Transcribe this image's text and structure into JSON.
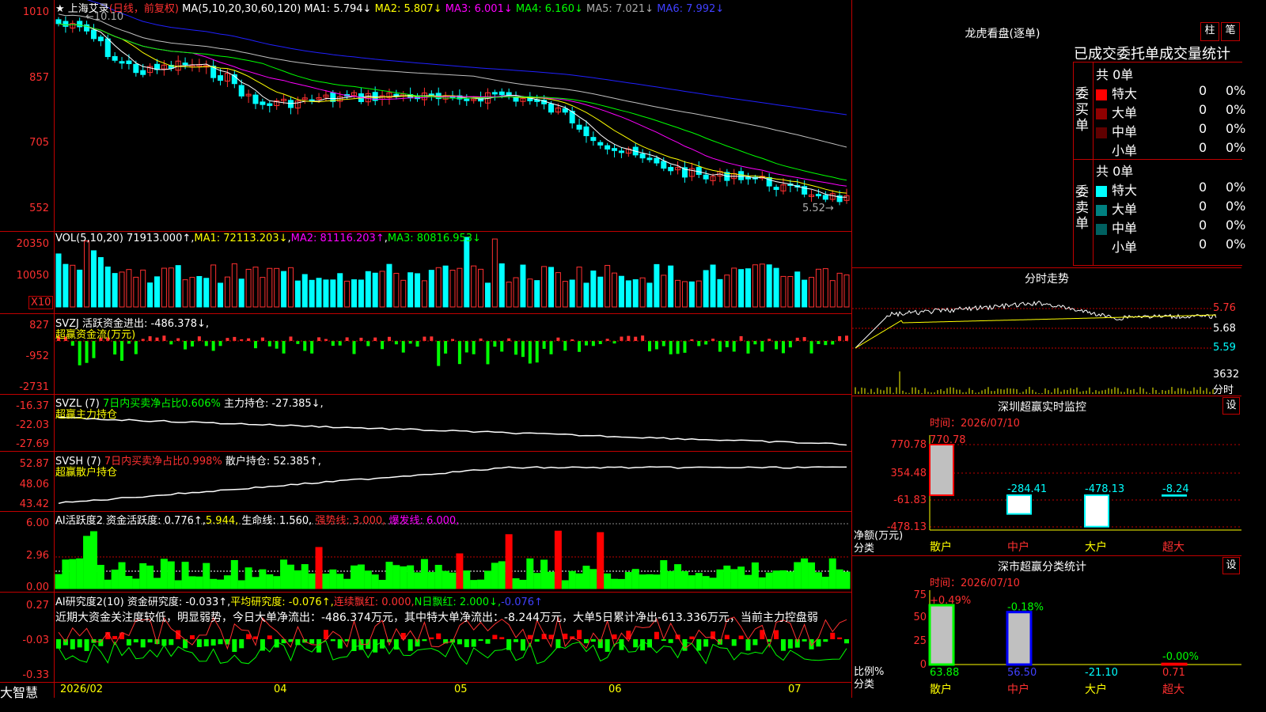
{
  "colors": {
    "up": "#ff3030",
    "down": "#00ffff",
    "grid": "#c00000",
    "ma1": "#ffffff",
    "ma2": "#ffff00",
    "ma3": "#ff00ff",
    "ma4": "#00ff00",
    "ma5": "#c0c0c0",
    "ma6": "#2020ff"
  },
  "stock": {
    "name": "上海艾录",
    "period": "(日线，前复权)",
    "ma_params": "MA(5,10,20,30,60,120)",
    "ma1": "MA1: 5.794↓",
    "ma2": "MA2: 5.807↓",
    "ma3": "MA3: 6.001↓",
    "ma4": "MA4: 6.160↓",
    "ma5": "MA5: 7.021↓",
    "ma6": "MA6: 7.992↓",
    "high_marker": "10.10",
    "low_marker": "5.52"
  },
  "price_axis": [
    "1010",
    "857",
    "705",
    "552"
  ],
  "volume": {
    "label": "VOL(5,10,20)",
    "value": "71913.000↑",
    "ma1": "MA1: 72113.203↓",
    "ma2": "MA2: 81116.203↑",
    "ma3": "MA3: 80816.953↓",
    "axis": [
      "20350",
      "10050"
    ],
    "unit": "X10"
  },
  "svzj": {
    "label": "SVZJ",
    "text": "活跃资金进出: -486.378↓,",
    "sub": "超赢资金流(万元)",
    "axis": [
      "827",
      "-952",
      "-2731"
    ]
  },
  "svzl": {
    "label": "SVZL (7)",
    "ratio": "7日内买卖净占比0.606%",
    "text": "主力持仓: -27.385↓,",
    "sub": "超赢主力持仓",
    "axis": [
      "-16.37",
      "-22.03",
      "-27.69"
    ]
  },
  "svsh": {
    "label": "SVSH (7)",
    "ratio": "7日内买卖净占比0.998%",
    "text": "散户持仓: 52.385↑,",
    "sub": "超赢散户持仓",
    "axis": [
      "52.87",
      "48.06",
      "43.42"
    ]
  },
  "ai_active": {
    "label": "AI活跃度2",
    "text1": "资金活跃度: 0.776↑,",
    "text2": "5.944,",
    "text3": "生命线: 1.560,",
    "text4": "强势线: 3.000,",
    "text5": "爆发线: 6.000,",
    "axis": [
      "6.00",
      "2.96",
      "0.00"
    ]
  },
  "ai_research": {
    "label": "AI研究度2(10)",
    "text1": "资金研究度: -0.033↑,",
    "text2": "平均研究度: -0.076↑,",
    "text3": "连续飘红: 0.000,",
    "text4": "N日飘红: 2.000↓,",
    "text5": "-0.076↑",
    "comment": "近期大资金关注度较低，明显弱势，今日大单净流出：-486.374万元，其中特大单净流出：-8.244万元，大单5日累计净出-613.336万元，当前主力控盘弱",
    "axis": [
      "0.27",
      "-0.03",
      "-0.33"
    ]
  },
  "x_axis": {
    "brand": "大智慧",
    "labels": [
      "2026/02",
      "04",
      "05",
      "06",
      "07"
    ]
  },
  "right_panel": {
    "dragon_title": "龙虎看盘(逐单)",
    "btn_bar": "柱",
    "btn_bar2": "笔",
    "stats_title": "已成交委托单成交量统计",
    "buy_side": "委买单",
    "sell_side": "委卖单",
    "buy_total": "共 0单",
    "sell_total": "共 0单",
    "buy_rows": [
      {
        "label": "特大",
        "count": "0",
        "pct": "0%",
        "color": "#ff0000"
      },
      {
        "label": "大单",
        "count": "0",
        "pct": "0%",
        "color": "#900000"
      },
      {
        "label": "中单",
        "count": "0",
        "pct": "0%",
        "color": "#600000"
      },
      {
        "label": "小单",
        "count": "0",
        "pct": "0%",
        "color": "#000000"
      }
    ],
    "sell_rows": [
      {
        "label": "特大",
        "count": "0",
        "pct": "0%",
        "color": "#00ffff"
      },
      {
        "label": "大单",
        "count": "0",
        "pct": "0%",
        "color": "#008080"
      },
      {
        "label": "中单",
        "count": "0",
        "pct": "0%",
        "color": "#006060"
      },
      {
        "label": "小单",
        "count": "0",
        "pct": "0%",
        "color": "#000000"
      }
    ],
    "intraday_title": "分时走势",
    "intraday_axis": [
      "5.76",
      "5.68",
      "5.59"
    ],
    "intraday_vol": "3632",
    "intraday_vol_label": "分时",
    "monitor_title": "深圳超赢实时监控",
    "monitor_date": "时间：2026/07/10",
    "monitor_axis": [
      "770.78",
      "354.48",
      "-61.83",
      "-478.13"
    ],
    "monitor_bars": [
      {
        "cat": "散户",
        "val": "770.78"
      },
      {
        "cat": "中户",
        "val": "-284.41"
      },
      {
        "cat": "大户",
        "val": "-478.13"
      },
      {
        "cat": "超大",
        "val": "-8.24"
      }
    ],
    "monitor_ylabel": "净额(万元)",
    "monitor_xlabel": "分类",
    "class_title": "深市超赢分类统计",
    "class_date": "时间：2026/07/10",
    "class_axis": [
      "75",
      "50",
      "25",
      "0"
    ],
    "class_bars": [
      {
        "cat": "散户",
        "top": "+0.49%",
        "bottom": "63.88"
      },
      {
        "cat": "中户",
        "top": "-0.18%",
        "bottom": "56.50"
      },
      {
        "cat": "大户",
        "top": "",
        "bottom": "-21.10"
      },
      {
        "cat": "超大",
        "top": "-0.00%",
        "bottom": "0.71"
      }
    ],
    "class_ylabel": "比例%",
    "class_xlabel": "分类",
    "set_btn": "设"
  }
}
